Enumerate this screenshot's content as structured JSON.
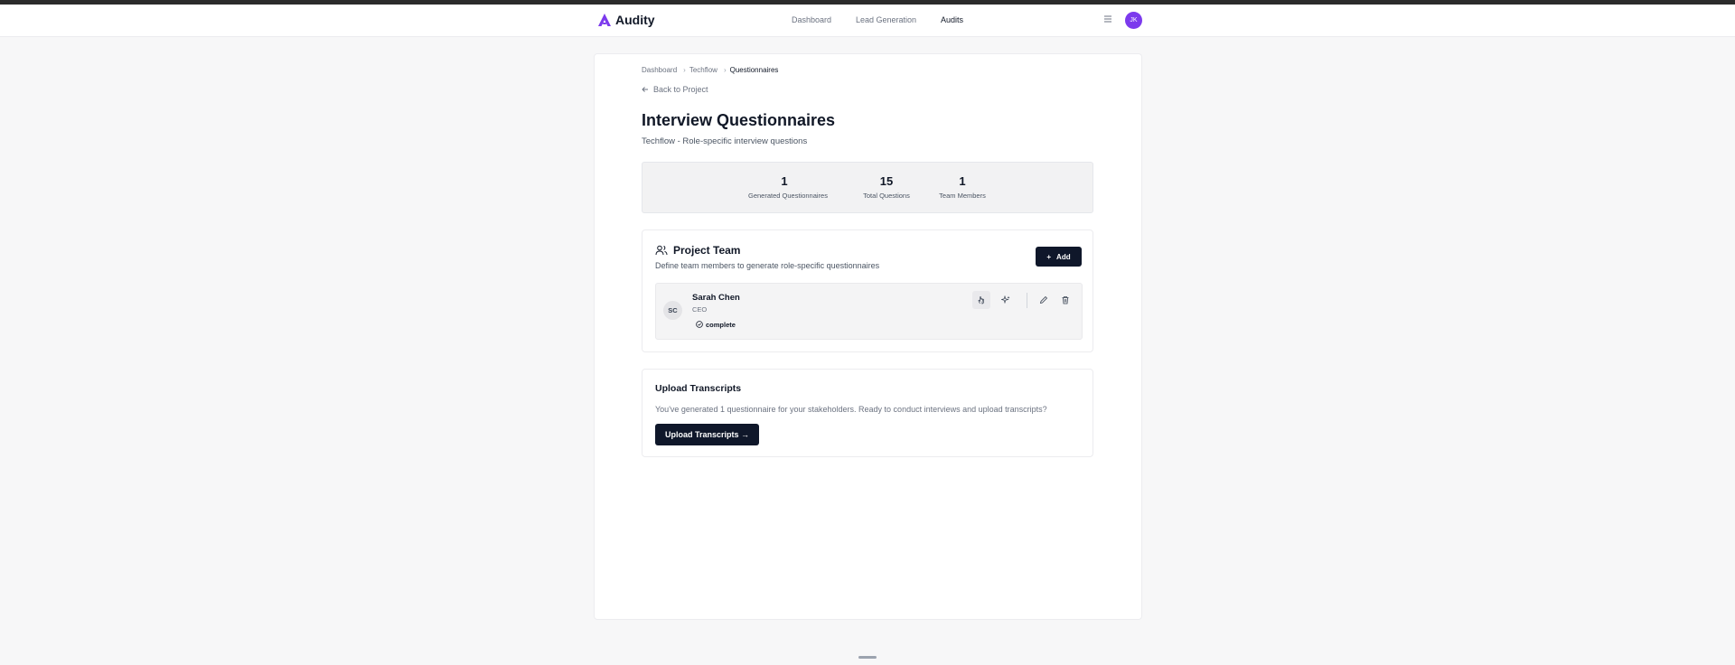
{
  "nav": {
    "brand": "Audity",
    "links": [
      "Dashboard",
      "Lead Generation",
      "Audits"
    ],
    "active": "Audits",
    "avatar_initials": "JK",
    "brand_color": "#7c3aed"
  },
  "breadcrumb": [
    "Dashboard",
    "Techflow",
    "Questionnaires"
  ],
  "back_link": "Back to Project",
  "header": {
    "title": "Interview Questionnaires",
    "subtitle": "Techflow - Role-specific interview questions"
  },
  "stats": [
    {
      "value": "1",
      "label": "Generated Questionnaires"
    },
    {
      "value": "15",
      "label": "Total Questions"
    },
    {
      "value": "1",
      "label": "Team Members"
    }
  ],
  "team": {
    "title": "Project Team",
    "description": "Define team members to generate role-specific questionnaires",
    "add_label": "Add",
    "members": [
      {
        "initials": "SC",
        "name": "Sarah Chen",
        "role": "CEO",
        "status": "complete"
      }
    ]
  },
  "upload": {
    "title": "Upload Transcripts",
    "text": "You've generated 1 questionnaire for your stakeholders. Ready to conduct interviews and upload transcripts?",
    "button_label": "Upload Transcripts →"
  }
}
